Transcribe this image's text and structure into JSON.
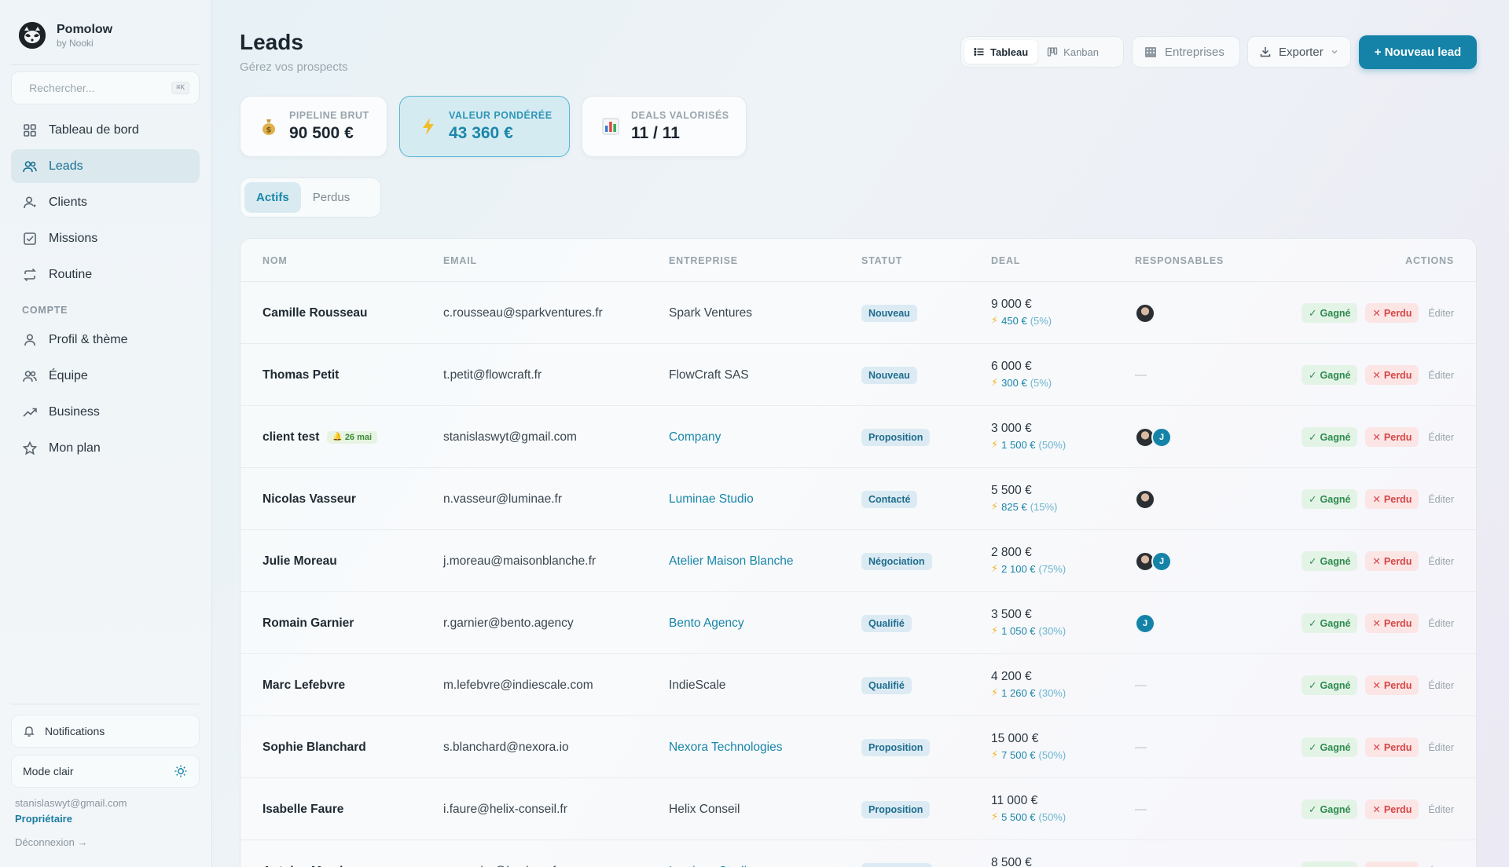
{
  "brand": {
    "name": "Pomolow",
    "sub": "by Nooki"
  },
  "search": {
    "placeholder": "Rechercher...",
    "shortcut": "⌘K"
  },
  "sidebar": {
    "items": [
      {
        "label": "Tableau de bord",
        "icon": "grid-icon",
        "active": false
      },
      {
        "label": "Leads",
        "icon": "users-icon",
        "active": true
      },
      {
        "label": "Clients",
        "icon": "user-icon",
        "active": false
      },
      {
        "label": "Missions",
        "icon": "checkbox-icon",
        "active": false
      },
      {
        "label": "Routine",
        "icon": "repeat-icon",
        "active": false
      }
    ],
    "section_label": "COMPTE",
    "account_items": [
      {
        "label": "Profil & thème",
        "icon": "user-icon"
      },
      {
        "label": "Équipe",
        "icon": "users-icon"
      },
      {
        "label": "Business",
        "icon": "trend-icon"
      },
      {
        "label": "Mon plan",
        "icon": "star-icon"
      }
    ],
    "notifications": "Notifications",
    "mode": "Mode clair",
    "user_email": "stanislaswyt@gmail.com",
    "user_role": "Propriétaire",
    "logout": "Déconnexion →"
  },
  "header": {
    "title": "Leads",
    "subtitle": "Gérez vos prospects",
    "view_table": "Tableau",
    "view_kanban": "Kanban",
    "entreprises": "Entreprises",
    "export": "Exporter",
    "new_lead": "+ Nouveau lead"
  },
  "kpis": [
    {
      "label": "PIPELINE BRUT",
      "value": "90 500 €",
      "icon": "money-bag-icon"
    },
    {
      "label": "VALEUR PONDÉRÉE",
      "value": "43 360 €",
      "icon": "bolt-icon"
    },
    {
      "label": "DEALS VALORISÉS",
      "value": "11 / 11",
      "icon": "bar-chart-icon"
    }
  ],
  "tabs": {
    "active": "Actifs",
    "lost": "Perdus"
  },
  "table": {
    "headers": [
      "NOM",
      "EMAIL",
      "ENTREPRISE",
      "STATUT",
      "DEAL",
      "RESPONSABLES",
      "ACTIONS"
    ],
    "actions": {
      "won": "Gagné",
      "lost": "Perdu",
      "edit": "Éditer"
    },
    "rows": [
      {
        "name": "Camille Rousseau",
        "email": "c.rousseau@sparkventures.fr",
        "company": "Spark Ventures",
        "company_link": false,
        "status": "Nouveau",
        "deal": "9 000 €",
        "weighted": "450 €",
        "pct": "(5%)",
        "resp": [
          "photo"
        ]
      },
      {
        "name": "Thomas Petit",
        "email": "t.petit@flowcraft.fr",
        "company": "FlowCraft SAS",
        "company_link": false,
        "status": "Nouveau",
        "deal": "6 000 €",
        "weighted": "300 €",
        "pct": "(5%)",
        "resp": []
      },
      {
        "name": "client test",
        "reminder": "26 mai",
        "email": "stanislaswyt@gmail.com",
        "company": "Company",
        "company_link": true,
        "status": "Proposition",
        "deal": "3 000 €",
        "weighted": "1 500 €",
        "pct": "(50%)",
        "resp": [
          "photo",
          "J"
        ]
      },
      {
        "name": "Nicolas Vasseur",
        "email": "n.vasseur@luminae.fr",
        "company": "Luminae Studio",
        "company_link": true,
        "status": "Contacté",
        "deal": "5 500 €",
        "weighted": "825 €",
        "pct": "(15%)",
        "resp": [
          "photo"
        ]
      },
      {
        "name": "Julie Moreau",
        "email": "j.moreau@maisonblanche.fr",
        "company": "Atelier Maison Blanche",
        "company_link": true,
        "status": "Négociation",
        "deal": "2 800 €",
        "weighted": "2 100 €",
        "pct": "(75%)",
        "resp": [
          "photo",
          "J"
        ]
      },
      {
        "name": "Romain Garnier",
        "email": "r.garnier@bento.agency",
        "company": "Bento Agency",
        "company_link": true,
        "status": "Qualifié",
        "deal": "3 500 €",
        "weighted": "1 050 €",
        "pct": "(30%)",
        "resp": [
          "J"
        ]
      },
      {
        "name": "Marc Lefebvre",
        "email": "m.lefebvre@indiescale.com",
        "company": "IndieScale",
        "company_link": false,
        "status": "Qualifié",
        "deal": "4 200 €",
        "weighted": "1 260 €",
        "pct": "(30%)",
        "resp": []
      },
      {
        "name": "Sophie Blanchard",
        "email": "s.blanchard@nexora.io",
        "company": "Nexora Technologies",
        "company_link": true,
        "status": "Proposition",
        "deal": "15 000 €",
        "weighted": "7 500 €",
        "pct": "(50%)",
        "resp": []
      },
      {
        "name": "Isabelle Faure",
        "email": "i.faure@helix-conseil.fr",
        "company": "Helix Conseil",
        "company_link": false,
        "status": "Proposition",
        "deal": "11 000 €",
        "weighted": "5 500 €",
        "pct": "(50%)",
        "resp": []
      },
      {
        "name": "Antoine Mercier",
        "email": "a.mercier@luminae.fr",
        "company": "Luminae Studio",
        "company_link": true,
        "status": "Négociation",
        "deal": "8 500 €",
        "weighted": "",
        "pct": "",
        "resp": []
      }
    ]
  }
}
